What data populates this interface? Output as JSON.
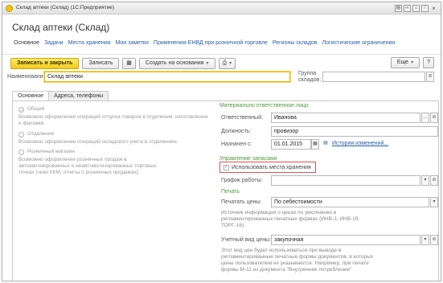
{
  "window": {
    "title": "Склад аптеки (Склад) (1С:Предприятие)",
    "title_icons": [
      "doc-icon",
      "link-icon",
      "clip-icon",
      "star-icon"
    ],
    "close_glyph": "×"
  },
  "form": {
    "title": "Склад аптеки (Склад)"
  },
  "nav": {
    "items": [
      "Основное",
      "Задачи",
      "Места хранения",
      "Мои заметки",
      "Применения ЕНВД при розничной торговле",
      "Регионы складов",
      "Логистические ограничения"
    ],
    "active_index": 0
  },
  "toolbar": {
    "save_close": "Записать и закрыть",
    "save": "Записать",
    "create_based": "Создать на основании",
    "more": "Еще",
    "help": "?"
  },
  "fields": {
    "name_label": "Наименование:",
    "name_value": "Склад аптеки",
    "group_label_1": "Группа",
    "group_label_2": "складов:",
    "group_value": ""
  },
  "tabs": [
    "Основное",
    "Адреса, телефоны"
  ],
  "left": {
    "opt1_label": "Общий",
    "opt1_desc": "Возможно оформление операций отпуска товаров в отделения, изготовления и фасовки.",
    "opt2_label": "Отделение",
    "opt2_desc": "Возможно оформление операций складского учета в отделениях.",
    "opt3_label": "Розничный магазин",
    "opt3_desc_1": "Возможно оформление розничных продаж в",
    "opt3_desc_2": "автоматизированных и неавтоматизированных торговых",
    "opt3_desc_3": "точках (чеки ККМ, отчеты о розничных продажах)."
  },
  "right": {
    "mol_title": "Материально ответственное лицо",
    "resp_label": "Ответственный:",
    "resp_value": "Иванова",
    "pos_label": "Должность:",
    "pos_value": "провизор",
    "assigned_label": "Назначен с:",
    "assigned_value": "01.01.2015",
    "history_link": "История изменений...",
    "stock_title": "Управление запасами",
    "use_storage_label": "Использовать места хранения",
    "schedule_label": "График работы:",
    "schedule_value": "",
    "print_title": "Печать",
    "print_prices_label": "Печатать цены:",
    "print_prices_value": "По себестоимости",
    "print_hint_1": "Источник информации о ценах по умолчанию в",
    "print_hint_2": "регламентированных печатных формах (ИНВ-3, ИНВ-19,",
    "print_hint_3": "ТОРГ-16).",
    "price_type_label": "Учетный вид цены:",
    "price_type_value": "закупочная",
    "price_hint_1": "Этот вид цен будет использоваться при выводе в",
    "price_hint_2": "регламентированные печатные формы документов, в которых",
    "price_hint_3": "цены пользователем не указываются. Например, при печати",
    "price_hint_4": "формы М-11 из документа \"Внутреннее потребление\""
  }
}
